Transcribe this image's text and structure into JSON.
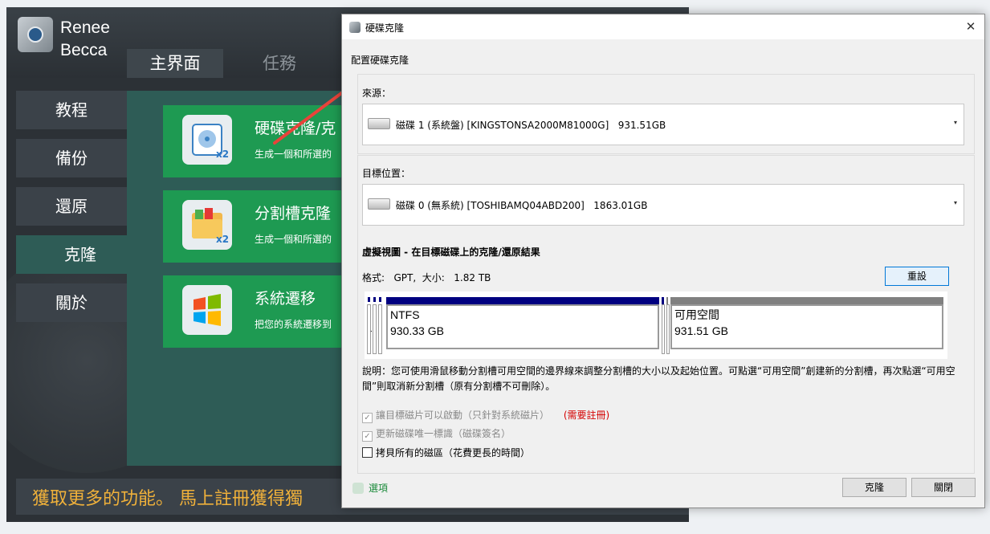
{
  "app": {
    "brand_line1": "Renee",
    "brand_line2": "Becca",
    "tabs": [
      "主界面",
      "任務"
    ],
    "sidebar": [
      "教程",
      "備份",
      "還原",
      "克隆",
      "關於"
    ],
    "cards": [
      {
        "title": "硬碟克隆/克",
        "desc": "生成一個和所選的",
        "badge": "x2"
      },
      {
        "title": "分割槽克隆",
        "desc": "生成一個和所選的",
        "badge": "x2"
      },
      {
        "title": "系統遷移",
        "desc": "把您的系統遷移到"
      }
    ],
    "promo": "獲取更多的功能。 馬上註冊獲得獨"
  },
  "dialog": {
    "title": "硬碟克隆",
    "config_label": "配置硬碟克隆",
    "source_label": "來源：",
    "source_value": "磁碟 1 (系統盤) [KINGSTONSA2000M81000G]   931.51GB",
    "target_label": "目標位置：",
    "target_value": "磁碟 0 (無系統) [TOSHIBAMQ04ABD200]   1863.01GB",
    "virtual_view_title": "虛擬視圖 - 在目標磁碟上的克隆/還原結果",
    "format_info": "格式:   GPT,  大小:   1.82 TB",
    "reset_button": "重設",
    "partitions": [
      {
        "fs": "NTFS",
        "size": "930.33 GB"
      },
      {
        "fs": "可用空間",
        "size": "931.51 GB"
      }
    ],
    "small_part_mark": ".",
    "description": "說明：您可使用滑鼠移動分割槽可用空間的邊界線來調整分割槽的大小以及起始位置。可點選“可用空間”創建新的分割槽，再次點選“可用空間”則取消新分割槽（原有分割槽不可刪除）。",
    "check1_label": "讓目標磁片可以啟動（只針對系統磁片）",
    "check1_note": "(需要註冊)",
    "check2_label": "更新磁碟唯一標識（磁碟簽名）",
    "check3_label": "拷貝所有的磁區（花費更長的時間）",
    "options_label": "選項",
    "clone_button": "克隆",
    "close_button": "關閉",
    "check_mark": "✓",
    "close_glyph": "✕",
    "arrow_glyph": "▾"
  },
  "colors": {
    "accent_green": "#1e9a52",
    "panel_teal": "#2e5c56",
    "promo_orange": "#f0b13a",
    "arrow_red": "#e8433a",
    "ntfs_bar": "#000080",
    "free_bar": "#808080",
    "register_red": "#d40000"
  }
}
